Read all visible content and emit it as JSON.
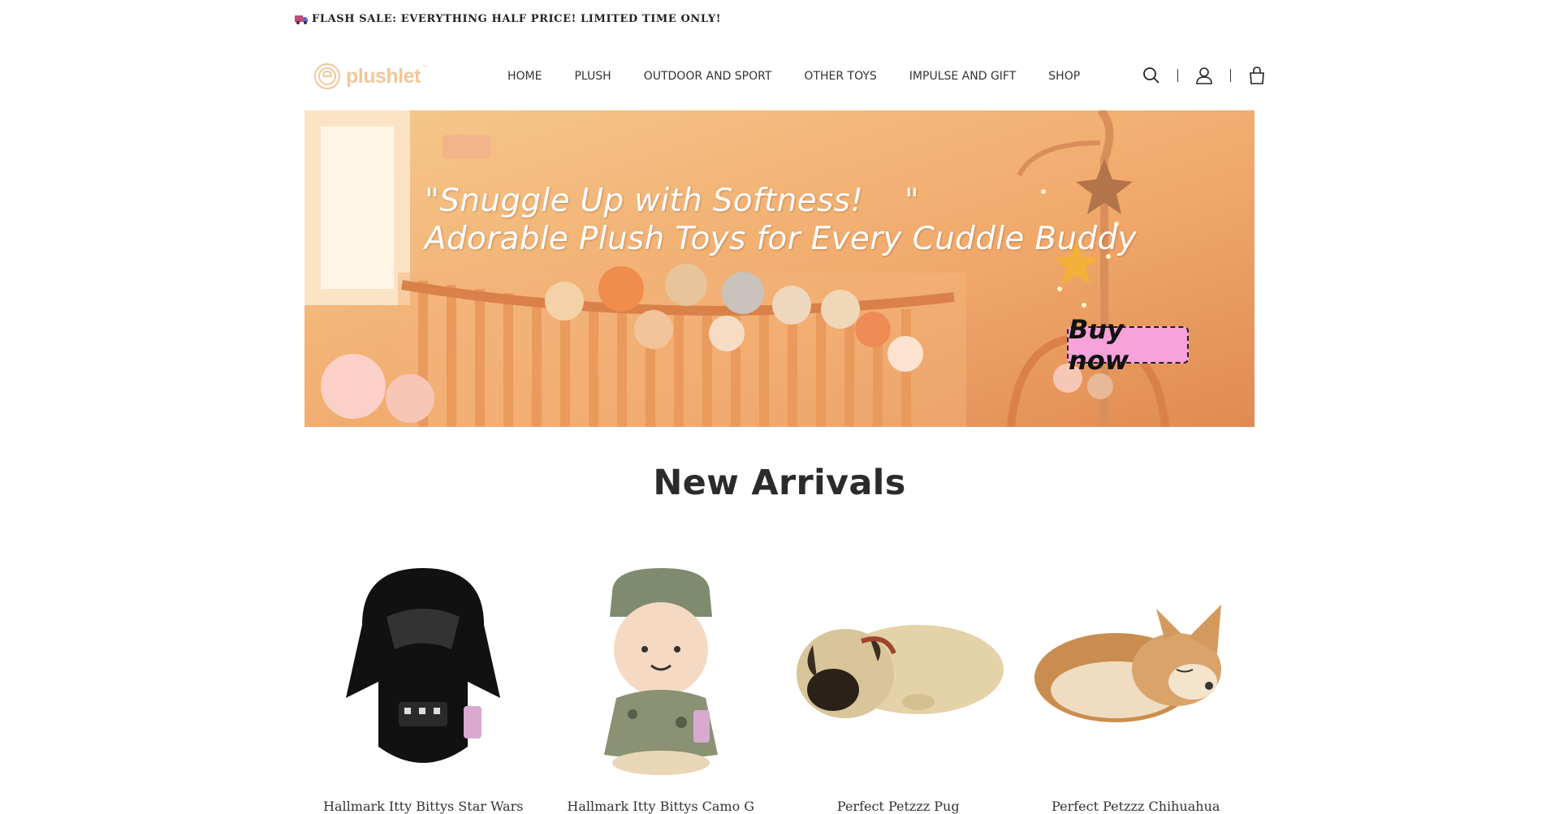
{
  "announcement": {
    "text": "FLASH SALE: EVERYTHING HALF PRICE! LIMITED TIME ONLY!",
    "icon": "truck-icon"
  },
  "header": {
    "logo_text": "plushlet",
    "logo_tm": "™",
    "nav": [
      "HOME",
      "PLUSH",
      "OUTDOOR AND SPORT",
      "OTHER TOYS",
      "IMPULSE AND GIFT",
      "SHOP"
    ],
    "icons": [
      "search-icon",
      "account-icon",
      "cart-icon"
    ]
  },
  "hero": {
    "line1": "\"Snuggle Up with Softness!    \"",
    "line2": "Adorable Plush Toys for Every Cuddle Buddy",
    "button": "Buy now"
  },
  "new_arrivals": {
    "title": "New Arrivals",
    "products": [
      {
        "name": "Hallmark Itty Bittys Star Wars"
      },
      {
        "name": "Hallmark Itty Bittys Camo G"
      },
      {
        "name": "Perfect Petzzz Pug"
      },
      {
        "name": "Perfect Petzzz Chihuahua"
      }
    ]
  },
  "colors": {
    "accent": "#f1c79a",
    "button_bg": "#f5a3d8",
    "text": "#222222"
  }
}
